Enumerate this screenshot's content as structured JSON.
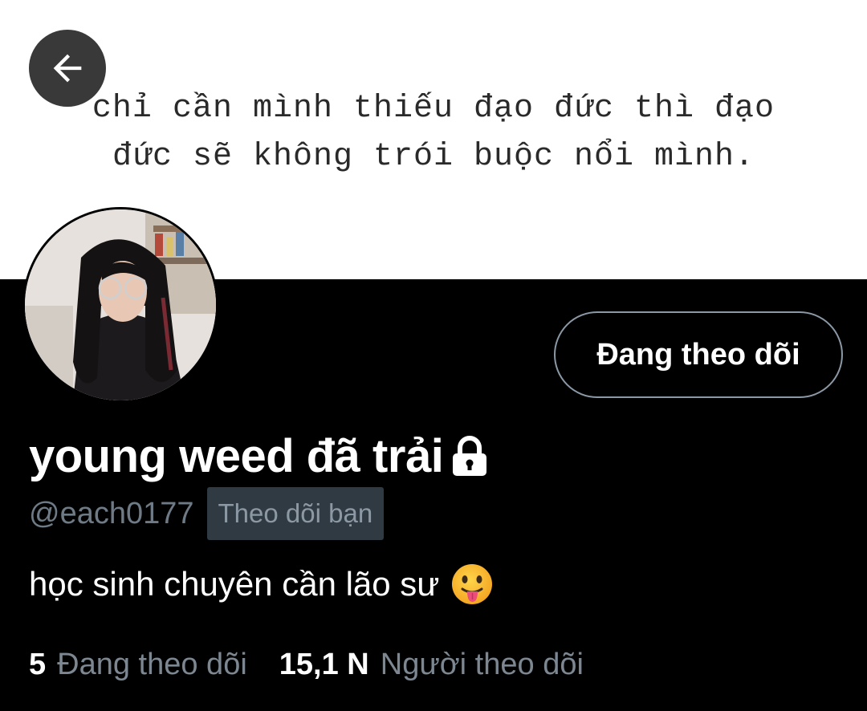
{
  "banner": {
    "quote_line1": "chỉ cần mình thiếu đạo đức thì đạo",
    "quote_line2": "đức sẽ không trói buộc nổi mình."
  },
  "nav": {
    "back_icon": "arrow-left-icon"
  },
  "profile": {
    "display_name": "young weed đã trải",
    "lock_icon": "lock-icon",
    "handle": "@each0177",
    "follows_you_badge": "Theo dõi bạn",
    "bio_text": "học sinh chuyên cần lão sư",
    "bio_emoji": "tongue-out-emoji",
    "follow_button_label": "Đang theo dõi"
  },
  "stats": {
    "following_count": "5",
    "following_label": "Đang theo dõi",
    "followers_count": "15,1 N",
    "followers_label": "Người theo dõi"
  },
  "colors": {
    "background": "#000000",
    "banner_bg": "#ffffff",
    "secondary_text": "#6e7b86",
    "badge_bg": "#2f3a43",
    "button_border": "#8b98a5"
  }
}
